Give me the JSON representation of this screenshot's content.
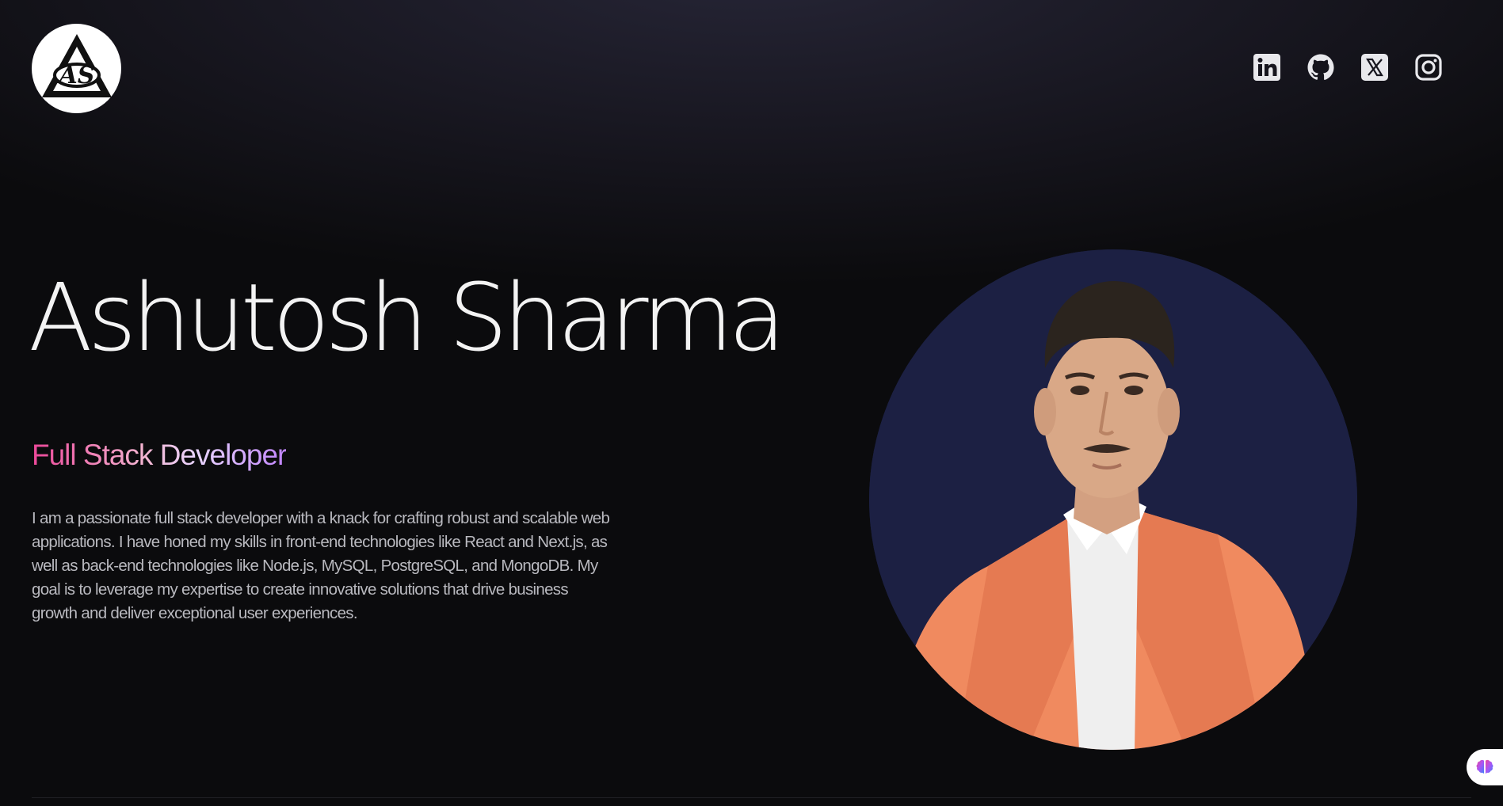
{
  "header": {
    "logo": {
      "text": "AS",
      "icon": "as-monogram-logo"
    },
    "social_links": [
      {
        "name": "linkedin",
        "icon": "linkedin-icon"
      },
      {
        "name": "github",
        "icon": "github-icon"
      },
      {
        "name": "x",
        "icon": "x-twitter-icon"
      },
      {
        "name": "instagram",
        "icon": "instagram-icon"
      }
    ]
  },
  "hero": {
    "name": "Ashutosh Sharma",
    "role": "Full Stack Developer",
    "bio": "I am a passionate full stack developer with a knack for crafting robust and scalable web applications. I have honed my skills in front-end technologies like React and Next.js, as well as back-end technologies like Node.js, MySQL, PostgreSQL, and MongoDB. My goal is to leverage my expertise to create innovative solutions that drive business growth and deliver exceptional user experiences.",
    "portrait": "profile-photo"
  },
  "floating": {
    "icon": "brain-icon"
  },
  "colors": {
    "background": "#0b0b0d",
    "role_gradient_start": "#ec4899",
    "role_gradient_end": "#c084fc",
    "portrait_bg": "#1c2043",
    "jacket": "#f08a5f"
  }
}
